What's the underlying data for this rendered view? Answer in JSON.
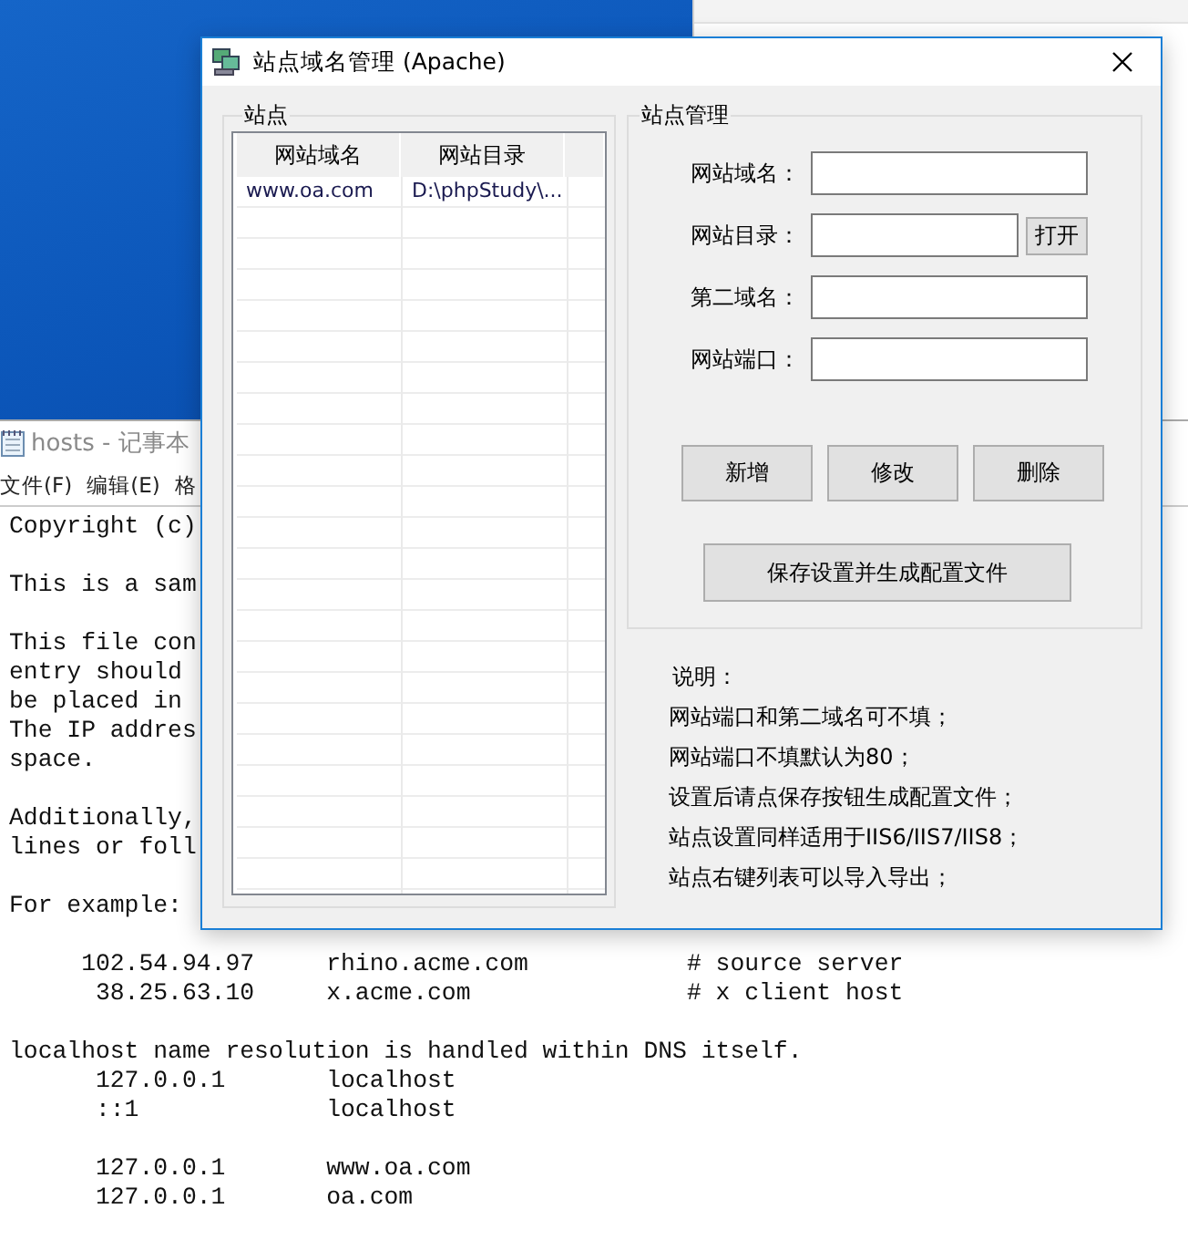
{
  "notepad": {
    "title": "hosts - 记事本",
    "menu": [
      "文件(F)",
      "编辑(E)",
      "格"
    ],
    "paragraphs": [
      [
        "Copyright (c)"
      ],
      [
        "This is a sam"
      ],
      [
        "This file con",
        "entry should",
        "be placed in",
        "The IP addres",
        "space."
      ],
      [
        "Additionally,",
        "lines or foll"
      ],
      [
        "For example:"
      ],
      [
        "     102.54.94.97     rhino.acme.com           # source server",
        "      38.25.63.10     x.acme.com               # x client host"
      ],
      [
        "localhost name resolution is handled within DNS itself.",
        "      127.0.0.1       localhost",
        "      ::1             localhost"
      ],
      [
        "      127.0.0.1       www.oa.com",
        "      127.0.0.1       oa.com"
      ]
    ]
  },
  "dialog": {
    "title": "站点域名管理 (Apache)",
    "sites": {
      "title": "站点",
      "columns": [
        "网站域名",
        "网站目录"
      ],
      "rows": [
        [
          "www.oa.com",
          "D:\\phpStudy\\..."
        ]
      ]
    },
    "manage": {
      "title": "站点管理",
      "fields": [
        {
          "label": "网站域名："
        },
        {
          "label": "网站目录：",
          "button": "打开"
        },
        {
          "label": "第二域名："
        },
        {
          "label": "网站端口："
        }
      ],
      "buttons": [
        "新增",
        "修改",
        "删除"
      ],
      "save_button": "保存设置并生成配置文件"
    },
    "notes": {
      "heading": "说明：",
      "lines": [
        "网站端口和第二域名可不填；",
        "网站端口不填默认为80；",
        "设置后请点保存按钮生成配置文件；",
        "站点设置同样适用于IIS6/IIS7/IIS8；",
        "站点右键列表可以导入导出；"
      ]
    }
  }
}
